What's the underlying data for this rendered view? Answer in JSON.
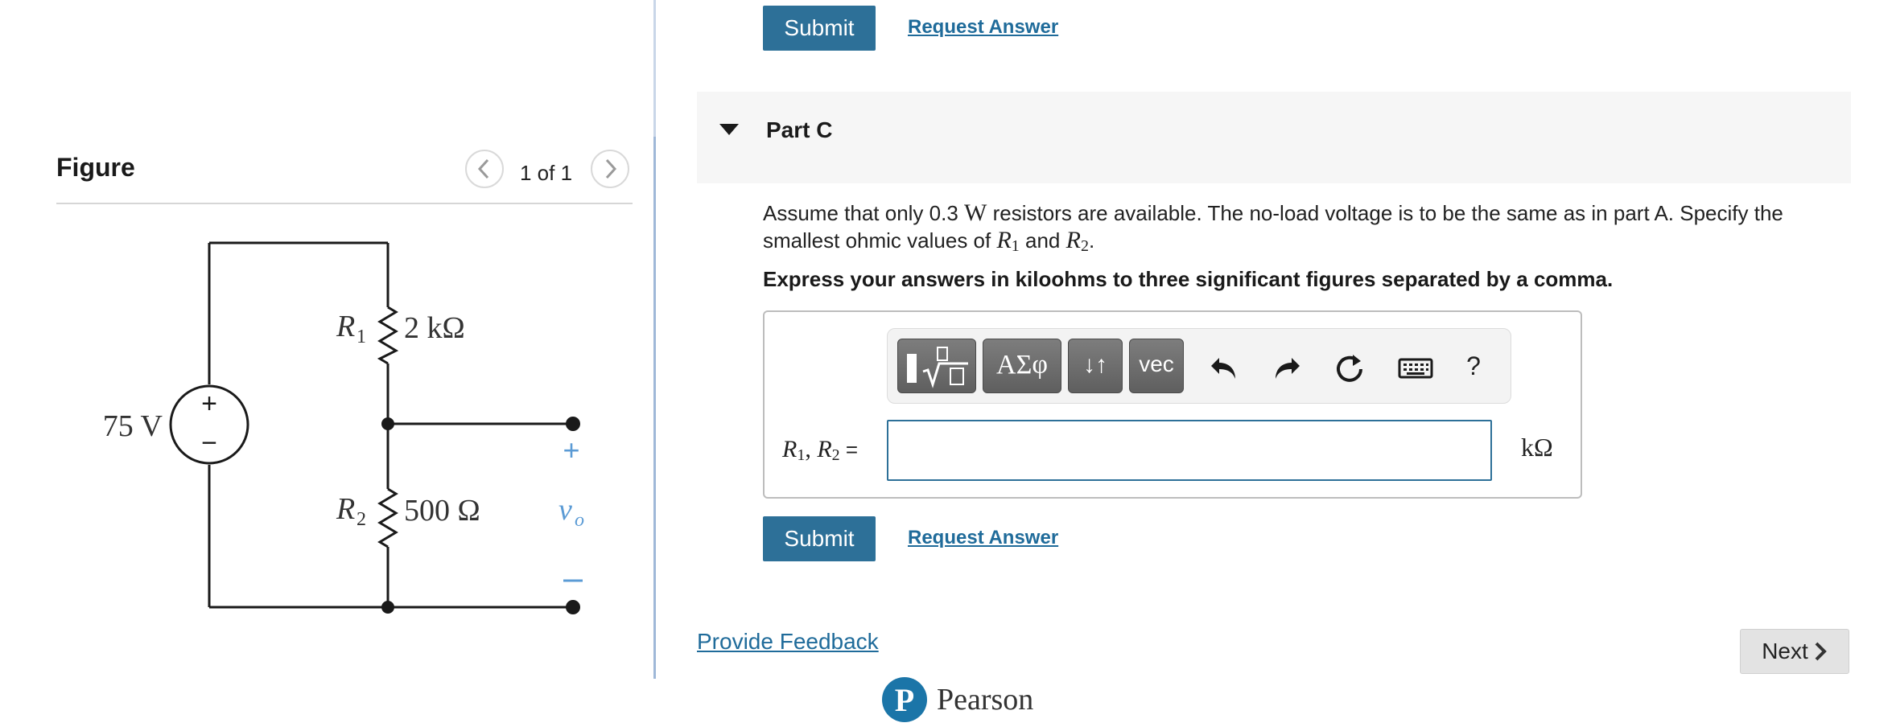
{
  "top_actions": {
    "submit_label": "Submit",
    "request_answer_label": "Request Answer"
  },
  "figure": {
    "title": "Figure",
    "pager_text": "1 of 1",
    "prev_icon": "chevron-left-icon",
    "next_icon": "chevron-right-icon",
    "circuit": {
      "source_label": "75 V",
      "source_plus": "+",
      "source_minus": "−",
      "r1_name": "R",
      "r1_sub": "1",
      "r1_value": "2 kΩ",
      "r2_name": "R",
      "r2_sub": "2",
      "r2_value": "500 Ω",
      "output_plus": "+",
      "output_minus": "−",
      "output_name": "v",
      "output_sub": "o",
      "output_color": "#5b9bd5"
    }
  },
  "part": {
    "title": "Part C",
    "question_before": "Assume that only 0.3 ",
    "question_unit": "W",
    "question_middle": " resistors are available. The no-load voltage is to be the same as in part A. Specify the smallest ohmic values of ",
    "var1_name": "R",
    "var1_sub": "1",
    "question_and": " and ",
    "var2_name": "R",
    "var2_sub": "2",
    "question_end": ".",
    "instructions": "Express your answers in kiloohms to three significant figures separated by a comma.",
    "toolbar": {
      "templates_icon": "fraction-sqrt-template-icon",
      "greek_label": "ΑΣφ",
      "arrows_label": "↓↑",
      "vec_label": "vec",
      "undo_icon": "undo-icon",
      "redo_icon": "redo-icon",
      "reset_icon": "reset-icon",
      "keyboard_icon": "keyboard-icon",
      "help_label": "?"
    },
    "answer_label_r1": "R",
    "answer_label_r1_sub": "1",
    "answer_label_sep": ", ",
    "answer_label_r2": "R",
    "answer_label_r2_sub": "2",
    "answer_label_eq": " =",
    "answer_value": "",
    "unit": "kΩ",
    "submit_label": "Submit",
    "request_answer_label": "Request Answer"
  },
  "footer": {
    "feedback_label": "Provide Feedback",
    "next_label": "Next",
    "next_icon": "chevron-right-icon",
    "brand_letter": "P",
    "brand_name": "Pearson"
  },
  "colors": {
    "accent": "#2d7098",
    "link": "#1f6b9a",
    "brand": "#1b75a8"
  }
}
